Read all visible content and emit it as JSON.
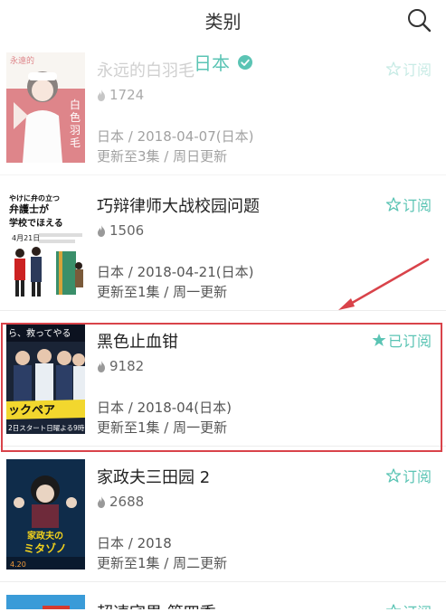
{
  "header": {
    "title": "类别"
  },
  "filter": {
    "label": "日本"
  },
  "colors": {
    "accent": "#5bc4b4",
    "highlight": "#d9434a"
  },
  "items": [
    {
      "title": "永远的白羽毛",
      "heat": "1724",
      "meta": "日本 / 2018-04-07(日本)",
      "update": "更新至3集 / 周日更新",
      "sub": "订阅"
    },
    {
      "title": "巧辩律师大战校园问题",
      "heat": "1506",
      "meta": "日本 / 2018-04-21(日本)",
      "update": "更新至1集 / 周一更新",
      "sub": "订阅"
    },
    {
      "title": "黑色止血钳",
      "heat": "9182",
      "meta": "日本 / 2018-04(日本)",
      "update": "更新至1集 / 周一更新",
      "sub": "已订阅"
    },
    {
      "title": "家政夫三田园 2",
      "heat": "2688",
      "meta": "日本 / 2018",
      "update": "更新至1集 / 周二更新",
      "sub": "订阅"
    },
    {
      "title": "超速宅男 第四季",
      "sub": "订阅"
    }
  ],
  "posters": {
    "p1": {
      "lines": [
        "白",
        "色",
        "羽",
        "毛"
      ],
      "corner": "永遠的"
    },
    "p2": {
      "lines": [
        "やけに弁の立つ",
        "弁護士が",
        "学校でほえる"
      ],
      "date": "4月21日"
    },
    "p3": {
      "top": "ら、救ってやる",
      "mid": "ックペア",
      "bottom": "2日スタート日曜よる9時"
    },
    "p4": {
      "line1": "家政夫の",
      "line2": "ミタゾノ",
      "date": "4.20"
    }
  }
}
